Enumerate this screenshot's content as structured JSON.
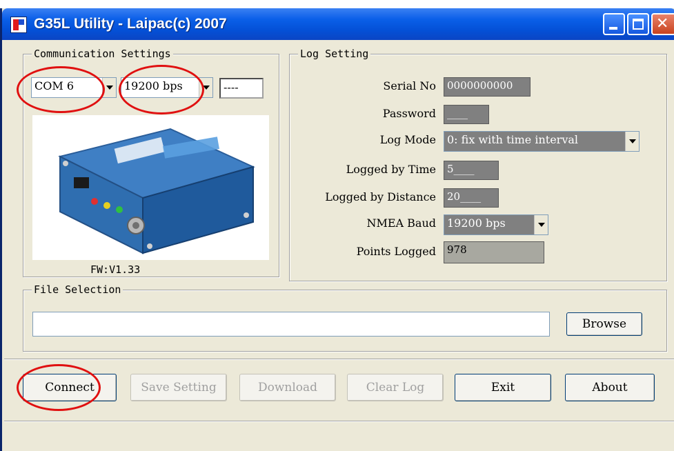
{
  "window": {
    "title": "G35L Utility - Laipac(c) 2007"
  },
  "communication": {
    "group_title": "Communication Settings",
    "com_port": "COM  6",
    "baud": "19200 bps",
    "password": "----",
    "fw_label": "FW:V1.33"
  },
  "log": {
    "group_title": "Log Setting",
    "serial_label": "Serial No",
    "serial_value": "0000000000",
    "password_label": "Password",
    "password_value": "____",
    "mode_label": "Log Mode",
    "mode_value": "0: fix with time interval",
    "time_label": "Logged by Time",
    "time_value": "5____",
    "distance_label": "Logged by Distance",
    "distance_value": "20____",
    "nmea_label": "NMEA Baud",
    "nmea_value": "19200 bps",
    "points_label": "Points Logged",
    "points_value": "978"
  },
  "file": {
    "group_title": "File Selection",
    "path": "",
    "browse_label": "Browse"
  },
  "buttons": {
    "connect": "Connect",
    "save_setting": "Save Setting",
    "download": "Download",
    "clear_log": "Clear Log",
    "exit": "Exit",
    "about": "About"
  },
  "colors": {
    "title_bar": "#0a5fe8",
    "annotation": "#e01010",
    "window_bg": "#ece9d8"
  }
}
